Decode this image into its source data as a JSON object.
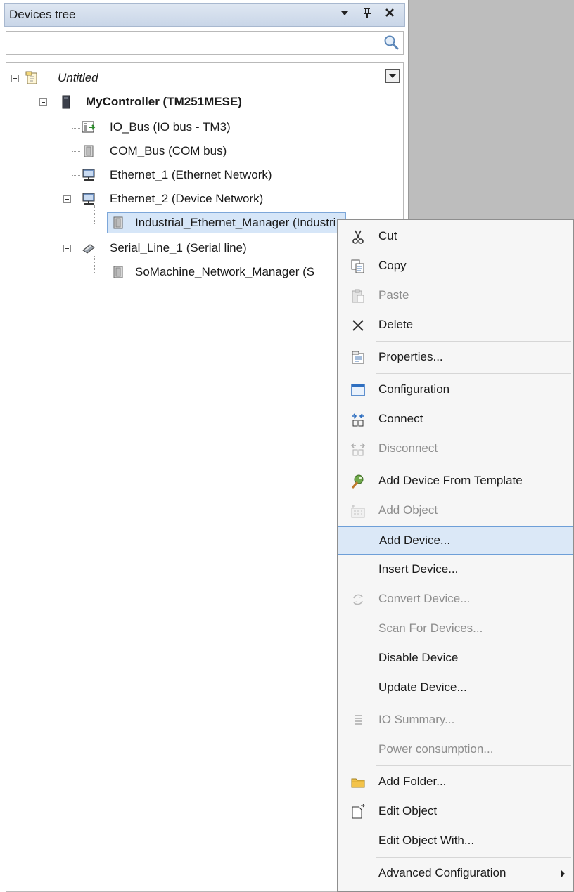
{
  "panel": {
    "title": "Devices tree",
    "controls": {
      "dropdown": "▾",
      "pin": "ꟸ",
      "close": "✕"
    },
    "search_value": ""
  },
  "tree": {
    "root": "Untitled",
    "controller": "MyController (TM251MESE)",
    "items": [
      "IO_Bus (IO bus - TM3)",
      "COM_Bus (COM bus)",
      "Ethernet_1 (Ethernet Network)",
      "Ethernet_2 (Device Network)",
      "Industrial_Ethernet_Manager (Industrial Et",
      "Serial_Line_1 (Serial line)",
      "SoMachine_Network_Manager (S"
    ]
  },
  "menu": {
    "items": [
      {
        "label": "Cut",
        "icon": "scissors-icon",
        "enabled": true
      },
      {
        "label": "Copy",
        "icon": "copy-icon",
        "enabled": true
      },
      {
        "label": "Paste",
        "icon": "paste-icon",
        "enabled": false
      },
      {
        "label": "Delete",
        "icon": "delete-icon",
        "enabled": true
      },
      {
        "label": "Properties...",
        "icon": "properties-icon",
        "enabled": true
      },
      {
        "label": "Configuration",
        "icon": "configuration-icon",
        "enabled": true
      },
      {
        "label": "Connect",
        "icon": "connect-icon",
        "enabled": true
      },
      {
        "label": "Disconnect",
        "icon": "disconnect-icon",
        "enabled": false
      },
      {
        "label": "Add Device From Template",
        "icon": "template-icon",
        "enabled": true
      },
      {
        "label": "Add Object",
        "icon": "add-object-icon",
        "enabled": false
      },
      {
        "label": "Add Device...",
        "icon": "",
        "enabled": true,
        "highlighted": true
      },
      {
        "label": "Insert Device...",
        "icon": "",
        "enabled": true
      },
      {
        "label": "Convert Device...",
        "icon": "convert-icon",
        "enabled": false
      },
      {
        "label": "Scan For Devices...",
        "icon": "",
        "enabled": false
      },
      {
        "label": "Disable Device",
        "icon": "",
        "enabled": true
      },
      {
        "label": "Update Device...",
        "icon": "",
        "enabled": true
      },
      {
        "label": "IO Summary...",
        "icon": "io-summary-icon",
        "enabled": false
      },
      {
        "label": "Power consumption...",
        "icon": "",
        "enabled": false
      },
      {
        "label": "Add Folder...",
        "icon": "folder-icon",
        "enabled": true
      },
      {
        "label": "Edit Object",
        "icon": "edit-object-icon",
        "enabled": true
      },
      {
        "label": "Edit Object With...",
        "icon": "",
        "enabled": true
      },
      {
        "label": "Advanced Configuration",
        "icon": "",
        "enabled": true,
        "submenu": true
      }
    ]
  },
  "colors": {
    "selection": "#d6e6f8",
    "menu_highlight": "#dbe8f7",
    "disabled_text": "#8d8d8d",
    "background_area": "#bdbdbd"
  }
}
